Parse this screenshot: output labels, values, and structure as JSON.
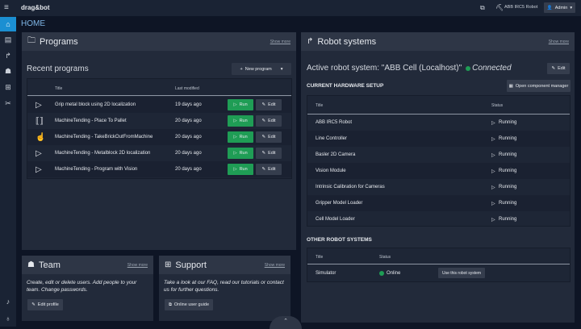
{
  "app": {
    "logo": "drag&bot",
    "robot": "ABB IRC5 Robot",
    "user": "Admin"
  },
  "page_title": "HOME",
  "sidebar": [
    "home-icon",
    "programs-icon",
    "robot-icon",
    "team-icon",
    "support-icon",
    "tools-icon"
  ],
  "programs": {
    "title": "Programs",
    "show_more": "Show more",
    "recent": "Recent programs",
    "new_program": "New program",
    "columns": [
      "Title",
      "Last modified"
    ],
    "rows": [
      {
        "icon": "play-icon",
        "title": "Grip metal block using 2D localization",
        "modified": "19 days ago"
      },
      {
        "icon": "skill-icon",
        "title": "MachineTending - Place To Pallet",
        "modified": "20 days ago"
      },
      {
        "icon": "hand-icon",
        "title": "MachineTending - TakeBrickOutFromMachine",
        "modified": "20 days ago"
      },
      {
        "icon": "play-icon",
        "title": "MachineTending - Metalblock 2D localization",
        "modified": "20 days ago"
      },
      {
        "icon": "play-icon",
        "title": "MachineTending - Program with Vision",
        "modified": "20 days ago"
      }
    ],
    "run": "Run",
    "edit": "Edit"
  },
  "robot": {
    "title": "Robot systems",
    "show_more": "Show more",
    "active": "Active robot system: \"ABB Cell (Localhost)\"",
    "status": "Connected",
    "edit": "Edit",
    "hw_title": "CURRENT HARDWARE SETUP",
    "open_manager": "Open component manager",
    "columns": [
      "Title",
      "Status"
    ],
    "hardware": [
      {
        "title": "ABB IRC5 Robot",
        "status": "Running"
      },
      {
        "title": "Line Controller",
        "status": "Running"
      },
      {
        "title": "Basler 2D Camera",
        "status": "Running"
      },
      {
        "title": "Vision Module",
        "status": "Running"
      },
      {
        "title": "Intrinsic Calibration for Cameras",
        "status": "Running"
      },
      {
        "title": "Gripper Model Loader",
        "status": "Running"
      },
      {
        "title": "Cell Model Loader",
        "status": "Running"
      }
    ],
    "other_title": "OTHER ROBOT SYSTEMS",
    "other": [
      {
        "title": "Simulator",
        "status": "Online",
        "action": "Use this robot system"
      }
    ]
  },
  "team": {
    "title": "Team",
    "show_more": "Show more",
    "desc": "Create, edit or delete users. Add people to your team. Change passwords.",
    "button": "Edit profile"
  },
  "support": {
    "title": "Support",
    "show_more": "Show more",
    "desc": "Take a look at our FAQ, read our tutorials or contact us for further questions.",
    "button": "Online user guide"
  },
  "colors": {
    "accent": "#1b8fd2",
    "success": "#1f9d55"
  }
}
